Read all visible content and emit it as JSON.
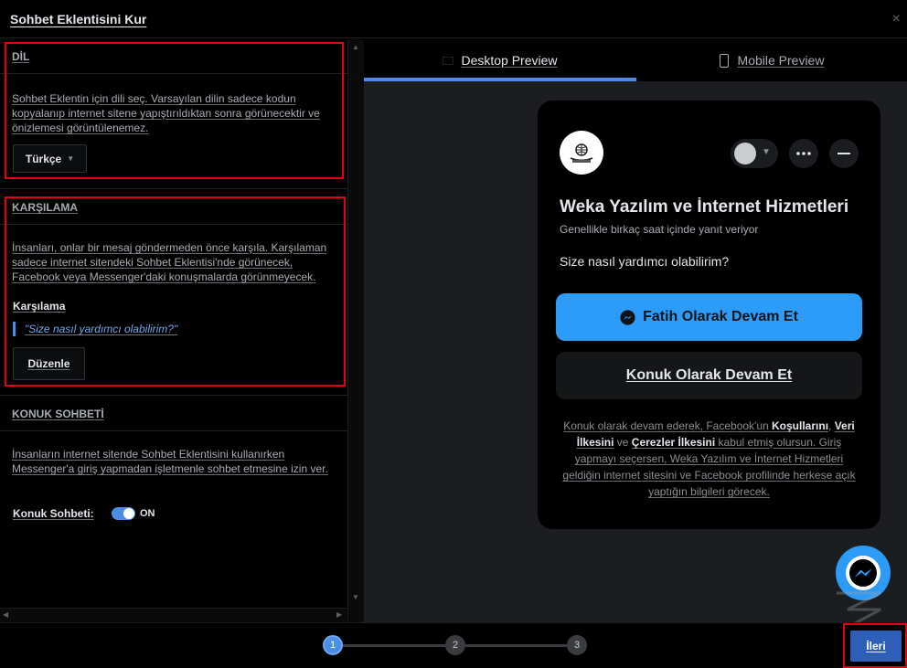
{
  "dialog": {
    "title": "Sohbet Eklentisini Kur",
    "close_glyph": "×"
  },
  "language": {
    "heading": "DİL",
    "description": "Sohbet Eklentin için dili seç. Varsayılan dilin sadece kodun kopyalanıp internet sitene yapıştırıldıktan sonra görünecektir ve önizlemesi görüntülenemez.",
    "selected": "Türkçe"
  },
  "greeting": {
    "heading": "KARŞILAMA",
    "description": "İnsanları, onlar bir mesaj göndermeden önce karşıla. Karşılaman sadece internet sitendeki Sohbet Eklentisi'nde görünecek, Facebook veya Messenger'daki konuşmalarda görünmeyecek.",
    "label": "Karşılama",
    "quote": "\"Size nasıl yardımcı olabilirim?\"",
    "edit_label": "Düzenle"
  },
  "guest_chat": {
    "heading": "KONUK SOHBETİ",
    "description": "İnsanların internet sitende Sohbet Eklentisini kullanırken Messenger'a giriş yapmadan işletmenle sohbet etmesine izin ver.",
    "toggle_label": "Konuk Sohbeti:",
    "toggle_state": "ON"
  },
  "preview": {
    "tabs": [
      {
        "label": "Desktop Preview",
        "active": true
      },
      {
        "label": "Mobile Preview",
        "active": false
      }
    ],
    "page_name": "Weka Yazılım ve İnternet Hizmetleri",
    "response_time": "Genellikle birkaç saat içinde yanıt veriyor",
    "greeting": "Size nasıl yardımcı olabilirim?",
    "continue_as": "Fatih Olarak Devam Et",
    "continue_guest": "Konuk Olarak Devam Et",
    "legal": {
      "p1": "Konuk olarak devam ederek, Facebook'un ",
      "terms": "Koşullarını",
      "sep": ", ",
      "data_policy": "Veri İlkesini",
      "and": " ve ",
      "cookie_policy": "Çerezler İlkesini",
      "p2": " kabul etmiş olursun. Giriş yapmayı seçersen, Weka Yazılım ve İnternet Hizmetleri geldiğin internet sitesini ve Facebook profilinde herkese açık yaptığın bilgileri görecek."
    }
  },
  "steps": [
    "1",
    "2",
    "3"
  ],
  "next_label": "İleri",
  "colors": {
    "accent": "#4a8ee8",
    "messenger_blue": "#2d9cf8",
    "highlight": "#e3000f"
  }
}
